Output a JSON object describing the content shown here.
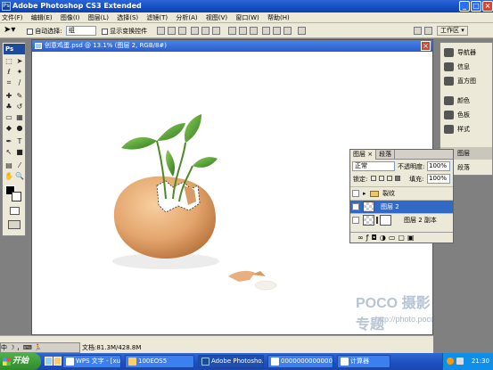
{
  "app": {
    "title": "Adobe Photoshop CS3 Extended",
    "title_icon": "Ps",
    "window_buttons": {
      "minimize": "_",
      "maximize": "□",
      "close": "×"
    }
  },
  "menu": [
    "文件(F)",
    "编辑(E)",
    "图像(I)",
    "图层(L)",
    "选择(S)",
    "滤镜(T)",
    "分析(A)",
    "视图(V)",
    "窗口(W)",
    "帮助(H)"
  ],
  "options_bar": {
    "auto_select_label": "自动选择:",
    "auto_select_value": "组",
    "show_transform_label": "显示变换控件",
    "workspace_label": "工作区 ▾"
  },
  "toolbox": {
    "logo": "Ps"
  },
  "document": {
    "title": "创意鸡蛋.psd @ 13.1% (图层 2, RGB/8#)",
    "watermark_brand": "POCO 摄影专题",
    "watermark_url": "http://photo.poco.cn/",
    "status_doc": "文档:81.3M/428.8M",
    "zoom": "13.1%"
  },
  "right_dock": {
    "items": [
      {
        "label": "导航器",
        "icon": "navigator-icon"
      },
      {
        "label": "信息",
        "icon": "info-icon"
      },
      {
        "label": "直方图",
        "icon": "histogram-icon"
      },
      {
        "label": "颜色",
        "icon": "color-icon"
      },
      {
        "label": "色板",
        "icon": "swatches-icon"
      },
      {
        "label": "样式",
        "icon": "styles-icon"
      },
      {
        "label": "图层",
        "icon": "layers-icon"
      },
      {
        "label": "段落",
        "icon": "paragraph-icon"
      }
    ]
  },
  "layers_panel": {
    "tabs": [
      "图层 ×",
      "段落"
    ],
    "blend_mode": "正常",
    "opacity_label": "不透明度:",
    "opacity_value": "100%",
    "lock_label": "锁定:",
    "fill_label": "填充:",
    "fill_value": "100%",
    "layers": [
      {
        "name": "裂纹",
        "type": "group",
        "selected": false
      },
      {
        "name": "图层 2",
        "type": "layer",
        "selected": true
      },
      {
        "name": "图层 2 副本",
        "type": "layer",
        "selected": false
      }
    ]
  },
  "ime_bar": {
    "text": "中 ☽ ，⌨ 🏃"
  },
  "taskbar": {
    "start_label": "开始",
    "items": [
      {
        "label": "WPS 文字 - [xu...",
        "active": false
      },
      {
        "label": "100EOS5",
        "active": false
      },
      {
        "label": "Adobe Photosho...",
        "active": true
      },
      {
        "label": "00000000000000...",
        "active": false
      },
      {
        "label": "计算器",
        "active": false
      }
    ],
    "clock": "21:30"
  },
  "colors": {
    "titlebar": "#0a3fb0",
    "taskbar": "#1d4fc0",
    "start": "#2f8a2c",
    "selected_layer": "#316ac5"
  }
}
